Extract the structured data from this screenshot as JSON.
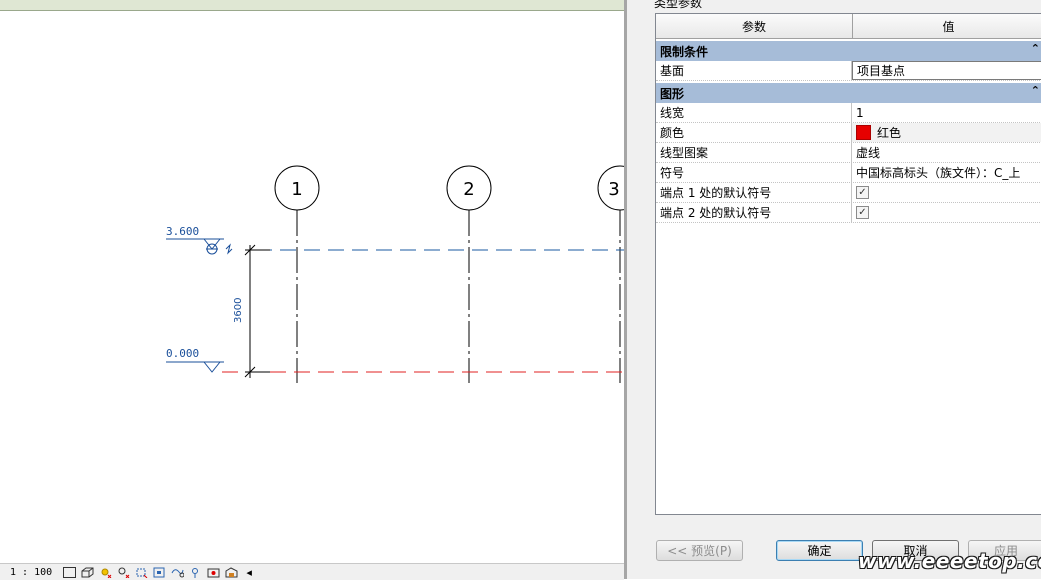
{
  "drawing": {
    "grid_labels": [
      "1",
      "2",
      "3"
    ],
    "level_top": "3.600",
    "level_bottom": "0.000",
    "dimension": "3600",
    "colors": {
      "level_top_line": "#1a5aa0",
      "level_bottom_line": "#e02020",
      "level_text": "#1a4f9a"
    }
  },
  "status_bar": {
    "scale": "1 : 100"
  },
  "dialog": {
    "title": "类型参数",
    "columns": {
      "param": "参数",
      "value": "值"
    },
    "groups": [
      {
        "name": "限制条件",
        "rows": [
          {
            "param": "基面",
            "value": "项目基点"
          }
        ]
      },
      {
        "name": "图形",
        "rows": [
          {
            "param": "线宽",
            "value": "1"
          },
          {
            "param": "颜色",
            "value": "红色",
            "swatch": "#e60000"
          },
          {
            "param": "线型图案",
            "value": "虚线"
          },
          {
            "param": "符号",
            "value": "中国标高标头（族文件）：C_上"
          },
          {
            "param": "端点 1 处的默认符号",
            "value": "✓"
          },
          {
            "param": "端点 2 处的默认符号",
            "value": "✓"
          }
        ]
      }
    ],
    "buttons": {
      "preview": "<< 预览(P)",
      "ok": "确定",
      "cancel": "取消",
      "apply": "应用"
    }
  },
  "watermark": "www.eeeetop.com"
}
